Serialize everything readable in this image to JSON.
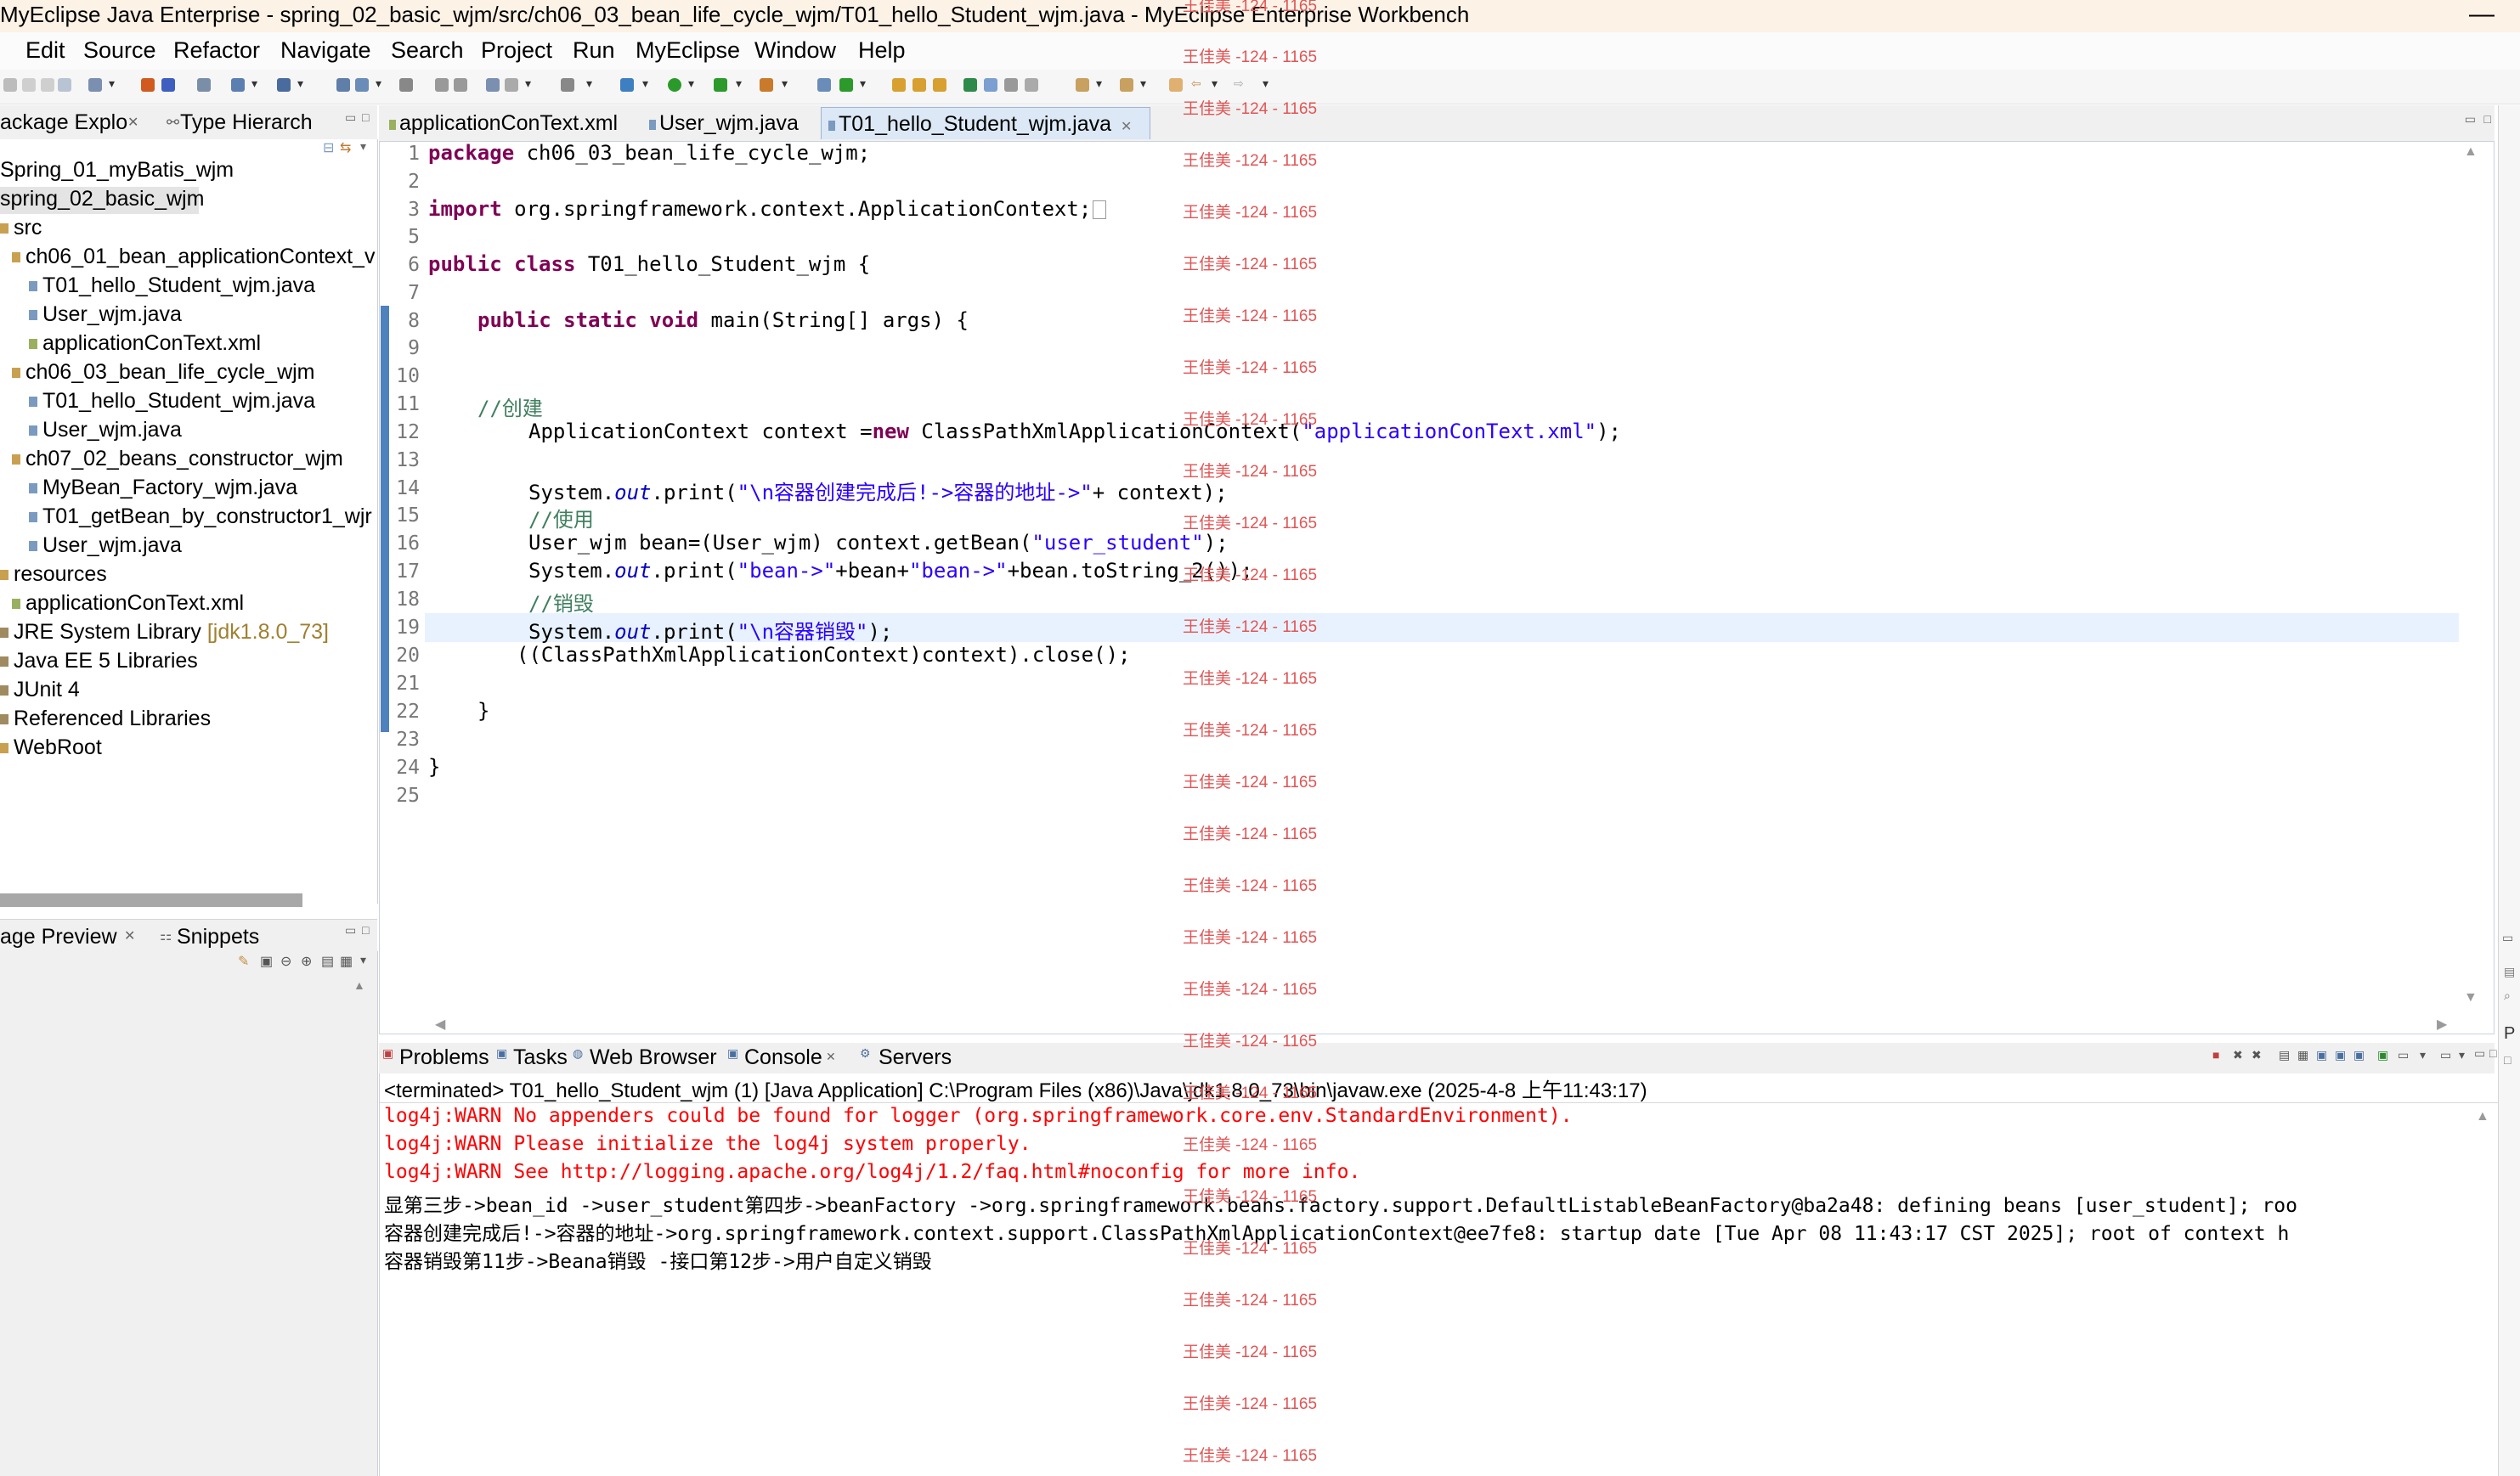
{
  "window": {
    "title": "MyEclipse Java Enterprise - spring_02_basic_wjm/src/ch06_03_bean_life_cycle_wjm/T01_hello_Student_wjm.java - MyEclipse Enterprise Workbench",
    "minimize": "—"
  },
  "menu": [
    "Edit",
    "Source",
    "Refactor",
    "Navigate",
    "Search",
    "Project",
    "Run",
    "MyEclipse",
    "Window",
    "Help"
  ],
  "left_top": {
    "tabs": [
      "ackage Explo",
      "Type Hierarch"
    ],
    "tree": [
      "Spring_01_myBatis_wjm",
      "spring_02_basic_wjm",
      "src",
      "ch06_01_bean_applicationContext_v",
      "T01_hello_Student_wjm.java",
      "User_wjm.java",
      "applicationConText.xml",
      "ch06_03_bean_life_cycle_wjm",
      "T01_hello_Student_wjm.java",
      "User_wjm.java",
      "ch07_02_beans_constructor_wjm",
      "MyBean_Factory_wjm.java",
      "T01_getBean_by_constructor1_wjr",
      "User_wjm.java",
      "resources",
      "applicationConText.xml",
      "JRE System Library",
      "Java EE 5 Libraries",
      "JUnit 4",
      "Referenced Libraries",
      "WebRoot"
    ],
    "jre_suffix": "[jdk1.8.0_73]"
  },
  "left_bottom": {
    "tabs": [
      "age Preview",
      "Snippets"
    ]
  },
  "editor": {
    "tabs": [
      "applicationConText.xml",
      "User_wjm.java",
      "T01_hello_Student_wjm.java"
    ],
    "active_tab": "T01_hello_Student_wjm.java",
    "line_numbers": [
      "1",
      "2",
      "3",
      "5",
      "6",
      "7",
      "8",
      "9",
      "10",
      "11",
      "12",
      "13",
      "14",
      "15",
      "16",
      "17",
      "18",
      "19",
      "20",
      "21",
      "22",
      "23",
      "24",
      "25"
    ],
    "code": {
      "l1_kw": "package",
      "l1_rest": " ch06_03_bean_life_cycle_wjm;",
      "l3_kw": "import",
      "l3_rest": " org.springframework.context.ApplicationContext;",
      "l6_kw": "public class",
      "l6_rest": " T01_hello_Student_wjm {",
      "l8_kw": "public static void",
      "l8_rest": " main(String[] args) {",
      "l11_cm": "//创建",
      "l12_a": "ApplicationContext context =",
      "l12_kw": "new",
      "l12_b": " ClassPathXmlApplicationContext(",
      "l12_str": "\"applicationConText.xml\"",
      "l12_c": ");",
      "l14_a": "System.",
      "l14_fld": "out",
      "l14_b": ".print(",
      "l14_str": "\"\\n容器创建完成后!->容器的地址->\"",
      "l14_c": "+ context);",
      "l15_cm": "//使用",
      "l16_a": "User_wjm bean=(User_wjm) context.getBean(",
      "l16_str": "\"user_student\"",
      "l16_c": ");",
      "l17_a": "System.",
      "l17_fld": "out",
      "l17_b": ".print(",
      "l17_str1": "\"bean->\"",
      "l17_c": "+bean+",
      "l17_str2": "\"bean->\"",
      "l17_d": "+bean.toString_2());",
      "l18_cm": "//销毁",
      "l19_a": "System.",
      "l19_fld": "out",
      "l19_b": ".print(",
      "l19_str": "\"\\n容器销毁\"",
      "l19_c": ");",
      "l20": "((ClassPathXmlApplicationContext)context).close();",
      "l22": "}",
      "l24": "}"
    }
  },
  "bottom": {
    "tabs": [
      "Problems",
      "Tasks",
      "Web Browser",
      "Console",
      "Servers"
    ],
    "status": "<terminated> T01_hello_Student_wjm (1) [Java Application] C:\\Program Files (x86)\\Java\\jdk1.8.0_73\\bin\\javaw.exe (2025-4-8 上午11:43:17)",
    "lines": [
      "log4j:WARN No appenders could be found for logger (org.springframework.core.env.StandardEnvironment).",
      "log4j:WARN Please initialize the log4j system properly.",
      "log4j:WARN See http://logging.apache.org/log4j/1.2/faq.html#noconfig for more info.",
      "显第三步->bean_id ->user_student第四步->beanFactory ->org.springframework.beans.factory.support.DefaultListableBeanFactory@ba2a48: defining beans [user_student]; roo",
      "容器创建完成后!->容器的地址->org.springframework.context.support.ClassPathXmlApplicationContext@ee7fe8: startup date [Tue Apr 08 11:43:17 CST 2025]; root of context h",
      "容器销毁第11步->Beana销毁 -接口第12步->用户自定义销毁"
    ]
  },
  "watermark": "王佳美 -124 - 1165",
  "colors": {
    "keyword": "#7f0055",
    "string": "#2a00ff",
    "comment": "#3f7f5f",
    "field": "#0000c0",
    "error": "#ff0000",
    "watermark": "#e05555"
  }
}
